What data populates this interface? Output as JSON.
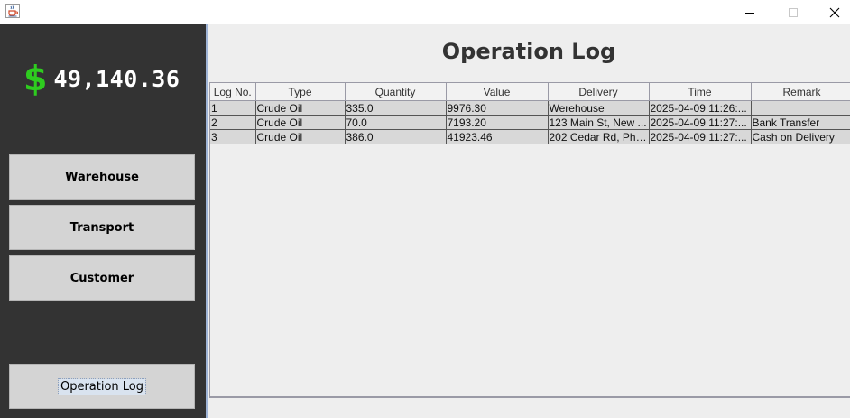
{
  "window": {
    "icon": "java-coffee-cup-icon",
    "controls": [
      "minimize-icon",
      "maximize-icon",
      "close-icon"
    ]
  },
  "sidebar": {
    "currency_symbol": "$",
    "balance": "49,140.36",
    "currency_color": "#2ecc1f",
    "items": [
      {
        "label": "Warehouse"
      },
      {
        "label": "Transport"
      },
      {
        "label": "Customer"
      },
      {
        "label": "Operation Log"
      }
    ]
  },
  "main": {
    "title": "Operation Log",
    "table": {
      "columns": [
        "Log No.",
        "Type",
        "Quantity",
        "Value",
        "Delivery",
        "Time",
        "Remark"
      ],
      "rows": [
        [
          "1",
          "Crude Oil",
          "335.0",
          "9976.30",
          "Werehouse",
          "2025-04-09 11:26:...",
          ""
        ],
        [
          "2",
          "Crude Oil",
          "70.0",
          "7193.20",
          "123 Main St, New ...",
          "2025-04-09 11:27:...",
          "Bank Transfer"
        ],
        [
          "3",
          "Crude Oil",
          "386.0",
          "41923.46",
          "202 Cedar Rd, Pho...",
          "2025-04-09 11:27:...",
          "Cash on Delivery"
        ]
      ]
    }
  }
}
